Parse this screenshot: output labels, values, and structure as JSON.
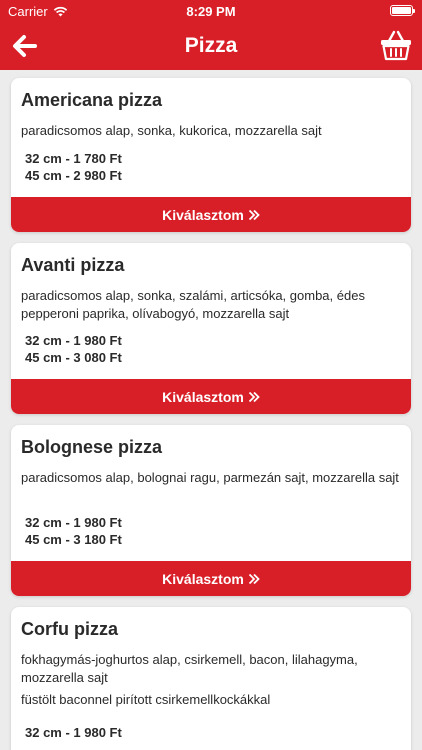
{
  "status_bar": {
    "carrier": "Carrier",
    "time": "8:29 PM"
  },
  "header": {
    "title": "Pizza"
  },
  "colors": {
    "accent": "#d81e27",
    "background": "#ececec",
    "card": "#ffffff"
  },
  "icons": {
    "back": "arrow-left-icon",
    "basket": "basket-icon",
    "wifi": "wifi-icon",
    "battery": "battery-icon",
    "chevron": "double-chevron-right-icon"
  },
  "pizzas": [
    {
      "name": "Americana pizza",
      "description": "paradicsomos alap, sonka, kukorica, mozzarella  sajt",
      "prices": [
        "32 cm - 1 780 Ft",
        "45 cm - 2 980 Ft"
      ],
      "button_label": "Kiválasztom"
    },
    {
      "name": "Avanti pizza",
      "description": "paradicsomos alap, sonka, szalámi, articsóka, gomba, édes pepperoni paprika, olívabogyó, mozzarella  sajt",
      "prices": [
        "32 cm - 1 980 Ft",
        "45 cm - 3 080 Ft"
      ],
      "button_label": "Kiválasztom"
    },
    {
      "name": "Bolognese pizza",
      "description": "paradicsomos alap, bolognai ragu, parmezán sajt, mozzarella  sajt",
      "prices": [
        "32 cm - 1 980 Ft",
        "45 cm - 3 180 Ft"
      ],
      "button_label": "Kiválasztom"
    },
    {
      "name": "Corfu pizza",
      "description": "fokhagymás-joghurtos alap, csirkemell, bacon, lilahagyma, mozzarella  sajt",
      "extra": "füstölt baconnel pirított csirkemellkockákkal",
      "prices": [
        "32 cm - 1 980 Ft"
      ]
    }
  ]
}
